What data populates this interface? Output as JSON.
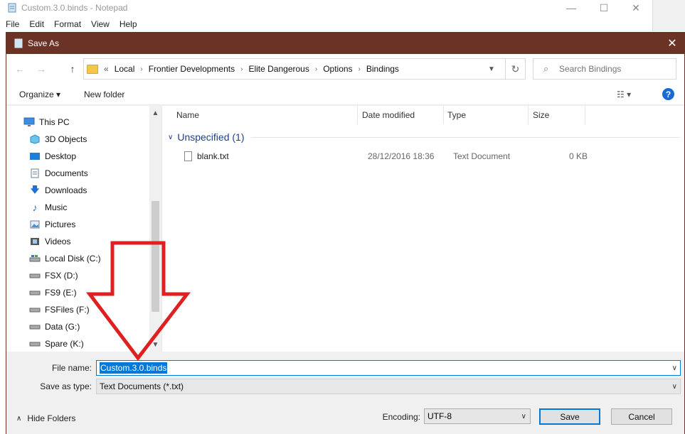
{
  "notepad": {
    "title": "Custom.3.0.binds - Notepad",
    "menu": [
      "File",
      "Edit",
      "Format",
      "View",
      "Help"
    ],
    "controls": {
      "minimize": "—",
      "maximize": "☐",
      "close": "✕"
    }
  },
  "dialog": {
    "title": "Save As",
    "close": "✕",
    "nav": {
      "back": "←",
      "forward": "→",
      "up": "↑"
    },
    "breadcrumb": [
      "«",
      "Local",
      "Frontier Developments",
      "Elite Dangerous",
      "Options",
      "Bindings"
    ],
    "search_placeholder": "Search Bindings",
    "toolbar": {
      "organize": "Organize ▾",
      "new_folder": "New folder",
      "help": "?"
    },
    "sidebar": {
      "items": [
        {
          "label": "This PC",
          "icon": "pc-icon"
        },
        {
          "label": "3D Objects",
          "icon": "cube-icon"
        },
        {
          "label": "Desktop",
          "icon": "desktop-icon"
        },
        {
          "label": "Documents",
          "icon": "documents-icon"
        },
        {
          "label": "Downloads",
          "icon": "download-icon"
        },
        {
          "label": "Music",
          "icon": "music-icon"
        },
        {
          "label": "Pictures",
          "icon": "pictures-icon"
        },
        {
          "label": "Videos",
          "icon": "videos-icon"
        },
        {
          "label": "Local Disk (C:)",
          "icon": "drive-icon"
        },
        {
          "label": "FSX (D:)",
          "icon": "drive-icon"
        },
        {
          "label": "FS9 (E:)",
          "icon": "drive-icon"
        },
        {
          "label": "FSFiles (F:)",
          "icon": "drive-icon"
        },
        {
          "label": "Data (G:)",
          "icon": "drive-icon"
        },
        {
          "label": "Spare (K:)",
          "icon": "drive-icon"
        }
      ]
    },
    "columns": [
      "Name",
      "Date modified",
      "Type",
      "Size"
    ],
    "group": {
      "label": "Unspecified (1)"
    },
    "files": [
      {
        "name": "blank.txt",
        "date": "28/12/2016 18:36",
        "type": "Text Document",
        "size": "0 KB"
      }
    ],
    "bottom": {
      "file_name_label": "File name:",
      "file_name_value": "Custom.3.0.binds",
      "save_type_label": "Save as type:",
      "save_type_value": "Text Documents (*.txt)",
      "hide_folders": "Hide Folders",
      "encoding_label": "Encoding:",
      "encoding_value": "UTF-8",
      "save": "Save",
      "cancel": "Cancel"
    }
  },
  "colors": {
    "title_bar": "#6b3325",
    "accent": "#0078d7",
    "arrow": "#e02020"
  }
}
